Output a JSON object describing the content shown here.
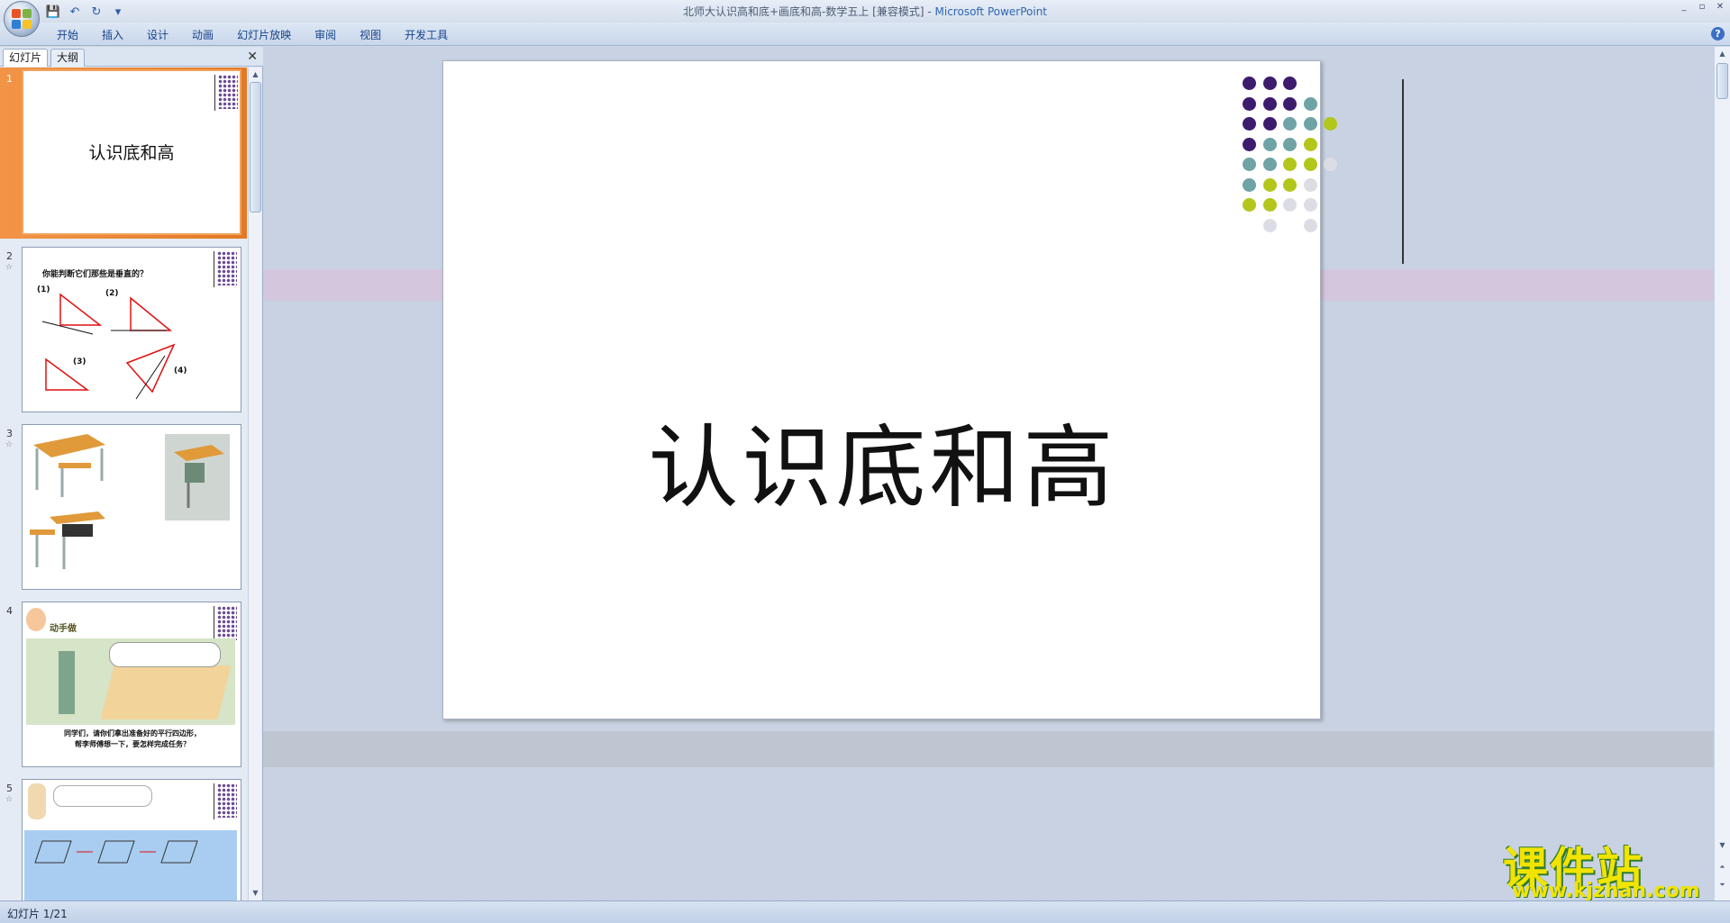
{
  "window": {
    "title": "北师大认识高和底+画底和高-数学五上 [兼容模式] - ",
    "app_name": "Microsoft PowerPoint",
    "controls": [
      "_",
      "▫",
      "✕"
    ]
  },
  "qat": {
    "save": "💾",
    "undo": "↶",
    "redo": "↻",
    "more": "▾"
  },
  "ribbon": {
    "tabs": [
      "开始",
      "插入",
      "设计",
      "动画",
      "幻灯片放映",
      "审阅",
      "视图",
      "开发工具"
    ],
    "help": "?"
  },
  "panel": {
    "tab_slides": "幻灯片",
    "tab_outline": "大纲",
    "close": "✕"
  },
  "thumbnails": [
    {
      "num": "1",
      "title": "认识底和高"
    },
    {
      "num": "2",
      "title": "你能判断它们那些是垂直的？",
      "labels": [
        "(1)",
        "(2)",
        "(3)",
        "(4)"
      ]
    },
    {
      "num": "3"
    },
    {
      "num": "4",
      "heading": "动手做",
      "caption_line1": "同学们，请你们拿出准备好的平行四边形，",
      "caption_line2": "帮李师傅想一下，要怎样完成任务？"
    },
    {
      "num": "5"
    }
  ],
  "slide": {
    "title": "认识底和高"
  },
  "watermark": {
    "cn": "课件站",
    "url": "www.kjzhan.com"
  },
  "status": {
    "text": "幻灯片 1/21"
  },
  "colors": {
    "purple": "#3d1c6e",
    "teal": "#6fa3a6",
    "lime": "#b3c61b",
    "gray": "#dcdde4"
  }
}
